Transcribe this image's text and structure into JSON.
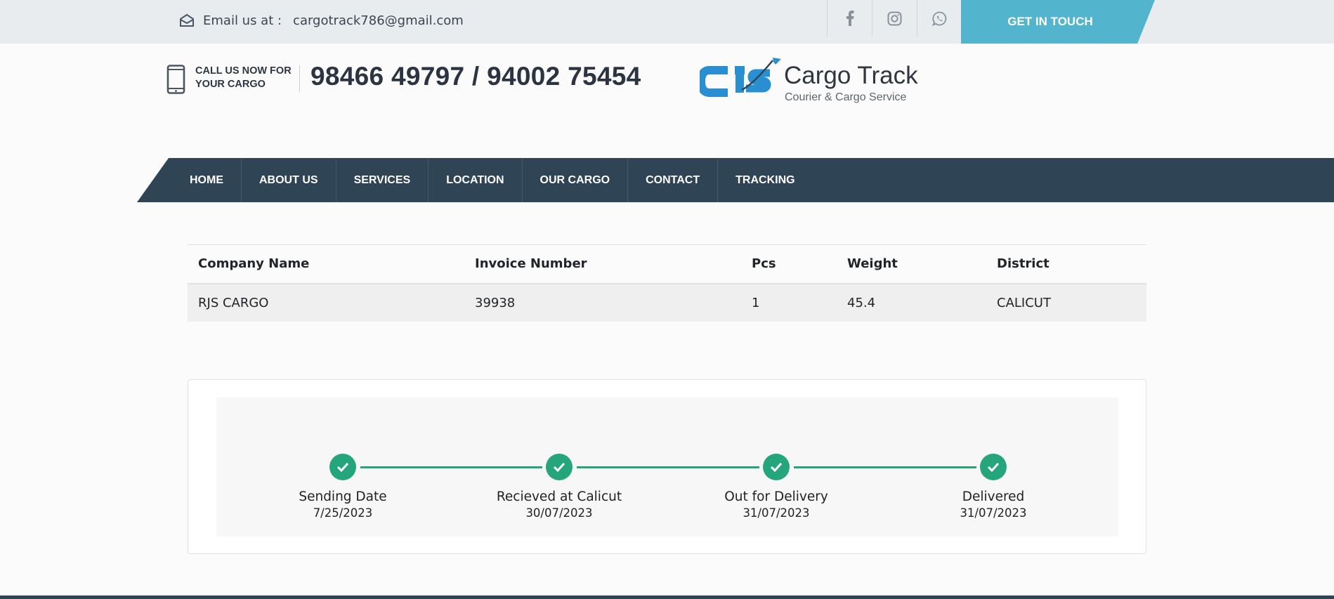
{
  "topbar": {
    "email_label": "Email us at :",
    "email": "cargotrack786@gmail.com",
    "social": [
      "facebook-icon",
      "instagram-icon",
      "whatsapp-icon"
    ],
    "cta": "GET IN TOUCH"
  },
  "header": {
    "call_line1": "CALL US NOW FOR",
    "call_line2": "YOUR CARGO",
    "phones": "98466 49797 / 94002 75454",
    "logo_title": "Cargo Track",
    "logo_subtitle": "Courier & Cargo Service"
  },
  "nav": {
    "items": [
      "HOME",
      "ABOUT US",
      "SERVICES",
      "LOCATION",
      "OUR CARGO",
      "CONTACT",
      "TRACKING"
    ]
  },
  "table": {
    "headers": [
      "Company Name",
      "Invoice Number",
      "Pcs",
      "Weight",
      "District"
    ],
    "rows": [
      [
        "RJS CARGO",
        "39938",
        "1",
        "45.4",
        "CALICUT"
      ]
    ]
  },
  "tracking": {
    "steps": [
      {
        "name": "Sending Date",
        "date": "7/25/2023"
      },
      {
        "name": "Recieved at Calicut",
        "date": "30/07/2023"
      },
      {
        "name": "Out for Delivery",
        "date": "31/07/2023"
      },
      {
        "name": "Delivered",
        "date": "31/07/2023"
      }
    ]
  },
  "colors": {
    "nav_bg": "#2f4455",
    "cta_bg": "#52b5cd",
    "brand_blue": "#2a8fd1",
    "success": "#24a57b"
  }
}
